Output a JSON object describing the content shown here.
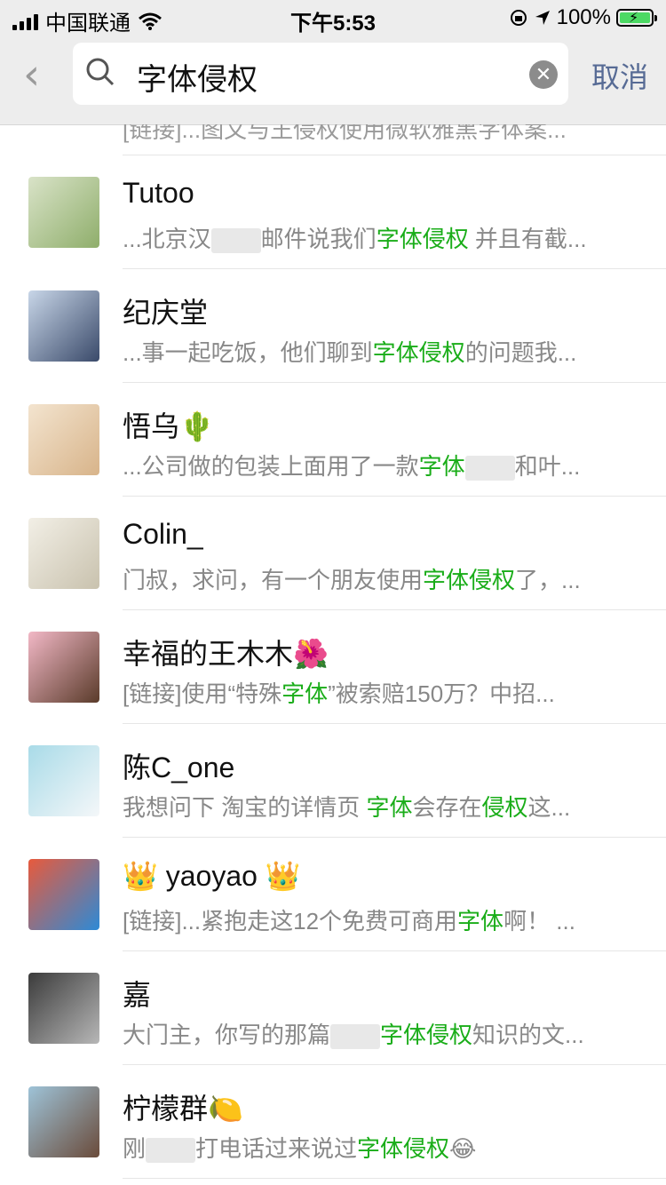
{
  "status": {
    "carrier": "中国联通",
    "time": "下午5:53",
    "battery": "100%",
    "accent": "#4cd964"
  },
  "search": {
    "query": "字体侵权",
    "cancel_label": "取消"
  },
  "partial_row": {
    "snippet": "[链接]...图文与王侵权使用微软雅黑字体案..."
  },
  "results": [
    {
      "name": "Tutoo",
      "pre": "...北京汉",
      "blur": true,
      "mid": "邮件说我们",
      "hl": "字体侵权",
      "post": " 并且有截..."
    },
    {
      "name": "纪庆堂",
      "pre": "...事一起吃饭，他们聊到",
      "hl": "字体侵权",
      "post": "的问题我..."
    },
    {
      "name": "悟乌",
      "emoji": "🌵",
      "pre": "...公司做的包装上面用了一款",
      "hl": "字体",
      "blur": true,
      "post": "和叶..."
    },
    {
      "name": "Colin_",
      "pre": "门叔，求问，有一个朋友使用",
      "hl": "字体侵权",
      "post": "了，..."
    },
    {
      "name": "幸福的王木木",
      "emoji": "🌺",
      "pre": "[链接]使用“特殊",
      "hl": "字体",
      "post": "”被索赔150万？中招..."
    },
    {
      "name": "陈C_one",
      "pre": "我想问下 淘宝的详情页 ",
      "hl": "字体",
      "mid2": "会存在",
      "hl2": "侵权",
      "post": "这..."
    },
    {
      "name": "yaoyao",
      "crown": "👑",
      "pre": "[链接]...紧抱走这12个免费可商用",
      "hl": "字体",
      "post": "啊！ ..."
    },
    {
      "name": "嘉",
      "pre": "大门主，你写的那篇",
      "blur": true,
      "hl": "字体侵权",
      "post": "知识的文..."
    },
    {
      "name": "柠檬群",
      "emoji": "🍋",
      "pre": "刚",
      "blur": true,
      "mid": "打电话过来说过",
      "hl": "字体侵权",
      "post": "😂"
    }
  ]
}
